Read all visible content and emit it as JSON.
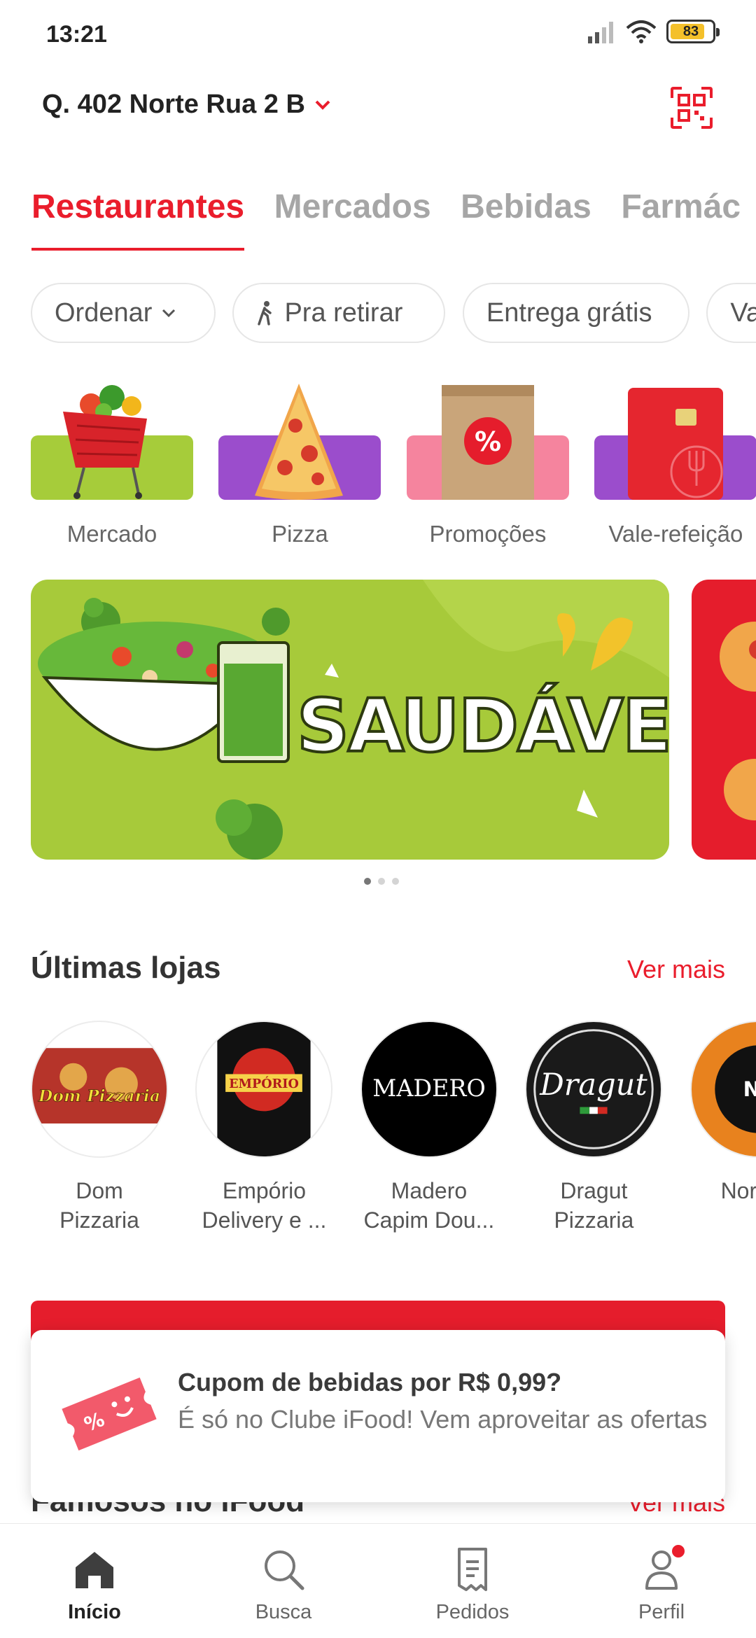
{
  "status_bar": {
    "time": "13:21",
    "battery": "83",
    "battery_level": 0.83
  },
  "header": {
    "address": "Q. 402 Norte Rua 2 B"
  },
  "tabs": [
    {
      "label": "Restaurantes",
      "active": true
    },
    {
      "label": "Mercados",
      "active": false
    },
    {
      "label": "Bebidas",
      "active": false
    },
    {
      "label": "Farmác",
      "active": false
    }
  ],
  "filters": [
    {
      "label": "Ordenar"
    },
    {
      "label": "Pra retirar"
    },
    {
      "label": "Entrega grátis"
    },
    {
      "label": "Va"
    }
  ],
  "categories": [
    {
      "label": "Mercado",
      "color": "#a6cc3a"
    },
    {
      "label": "Pizza",
      "color": "#9b4dcc"
    },
    {
      "label": "Promoções",
      "color": "#f5849e"
    },
    {
      "label": "Vale-refeição",
      "color": "#9b4dcc"
    }
  ],
  "banner": {
    "title": "SAUDÁVEIS",
    "color": "#a7ca3a"
  },
  "recent_stores": {
    "title": "Últimas lojas",
    "see_more": "Ver mais",
    "items": [
      {
        "line1": "Dom",
        "line2": "Pizzaria",
        "logo_text": "Dom Pizzaria"
      },
      {
        "line1": "Empório",
        "line2": "Delivery e ...",
        "logo_text": "EMPÓRIO"
      },
      {
        "line1": "Madero",
        "line2": "Capim Dou...",
        "logo_text": "MADERO"
      },
      {
        "line1": "Dragut",
        "line2": "Pizzaria",
        "logo_text": "Dragut"
      },
      {
        "line1": "North P",
        "line2": "",
        "logo_text": "NOR"
      }
    ]
  },
  "famous": {
    "title": "Famosos no iFood",
    "see_more": "Ver mais"
  },
  "coupon_card": {
    "title": "Cupom de bebidas por R$ 0,99?",
    "description": "É só no Clube iFood! Vem aproveitar as ofertas"
  },
  "bottom_nav": [
    {
      "label": "Início",
      "active": true
    },
    {
      "label": "Busca",
      "active": false
    },
    {
      "label": "Pedidos",
      "active": false
    },
    {
      "label": "Perfil",
      "active": false
    }
  ],
  "colors": {
    "brand": "#ea1d2c",
    "tab_inactive": "#a6a6a6"
  }
}
